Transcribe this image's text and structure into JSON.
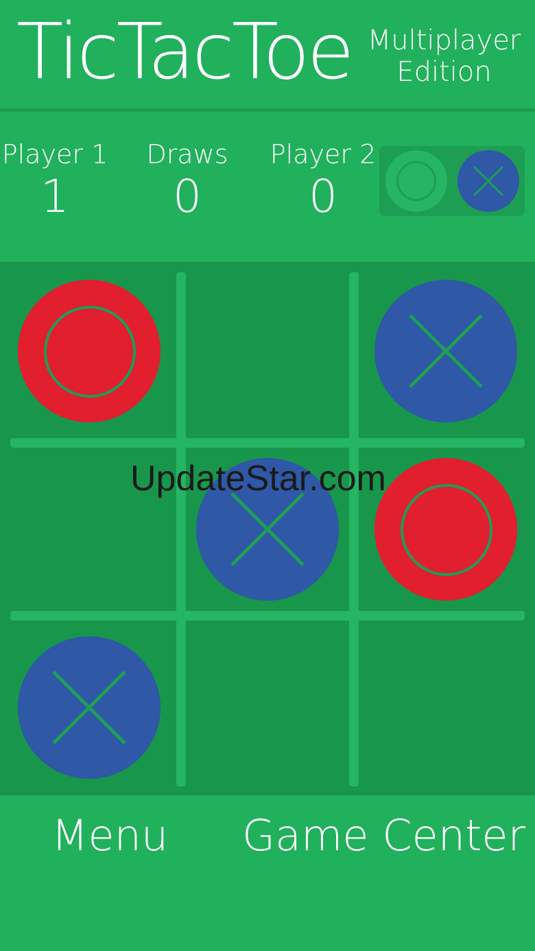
{
  "header": {
    "title": "TicTacToe",
    "subtitle_line1": "Multiplayer",
    "subtitle_line2": "Edition"
  },
  "scoreboard": {
    "player1": {
      "label": "Player 1",
      "score": "1"
    },
    "draws": {
      "label": "Draws",
      "score": "0"
    },
    "player2": {
      "label": "Player 2",
      "score": "0"
    }
  },
  "turn_indicator": {
    "player1_symbol": "O",
    "player2_symbol": "X",
    "active": "X"
  },
  "board": {
    "cells": [
      "O",
      "",
      "X",
      "",
      "X",
      "O",
      "X",
      "",
      ""
    ]
  },
  "watermark": "UpdateStar.com",
  "footer": {
    "menu_label": "Menu",
    "game_center_label": "Game Center"
  },
  "colors": {
    "background": "#21b05c",
    "board": "#18964c",
    "o_piece": "#e21f2f",
    "x_piece": "#2f58a6",
    "text": "#ffffff"
  }
}
